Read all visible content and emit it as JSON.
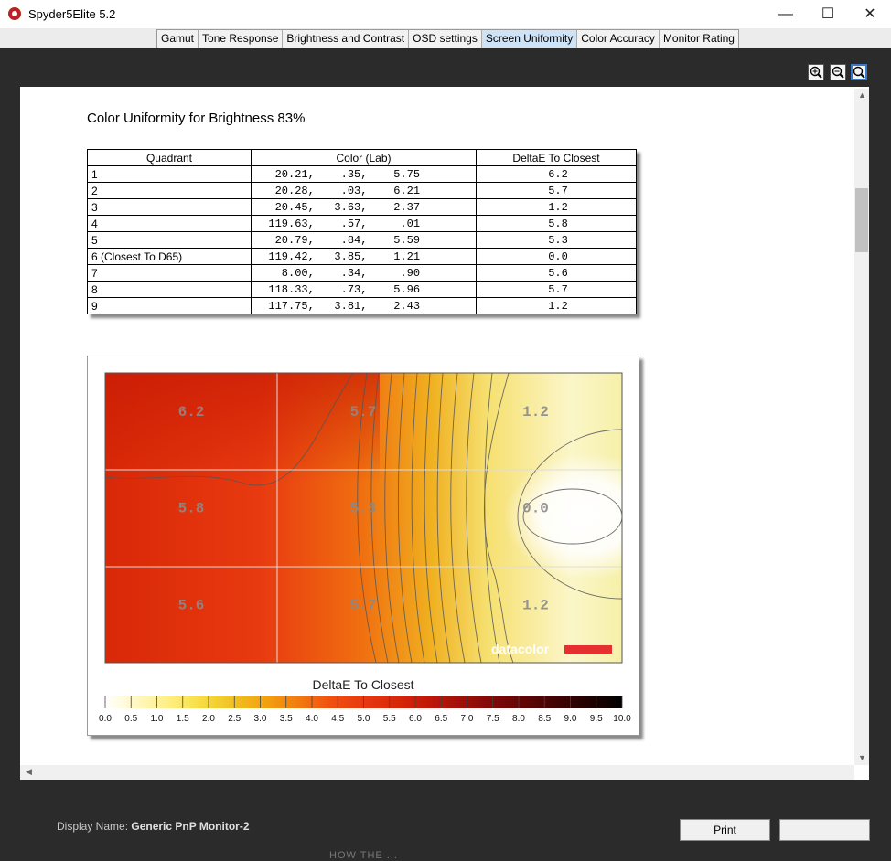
{
  "window": {
    "title": "Spyder5Elite 5.2",
    "minimize": "—",
    "maximize": "☐",
    "close": "✕"
  },
  "tabs": [
    {
      "label": "Gamut"
    },
    {
      "label": "Tone Response"
    },
    {
      "label": "Brightness and Contrast"
    },
    {
      "label": "OSD settings"
    },
    {
      "label": "Screen Uniformity",
      "active": true
    },
    {
      "label": "Color Accuracy"
    },
    {
      "label": "Monitor Rating"
    }
  ],
  "zoom_tools": [
    "zoom-in-icon",
    "zoom-out-icon",
    "zoom-fit-icon"
  ],
  "report": {
    "title": "Color Uniformity for Brightness 83%",
    "table": {
      "headers": [
        "Quadrant",
        "Color (Lab)",
        "DeltaE To Closest"
      ],
      "rows": [
        {
          "quadrant": "1",
          "lab": "   20.21,    .35,    5.75",
          "delta": "6.2"
        },
        {
          "quadrant": "2",
          "lab": "   20.28,    .03,    6.21",
          "delta": "5.7"
        },
        {
          "quadrant": "3",
          "lab": "   20.45,   3.63,    2.37",
          "delta": "1.2"
        },
        {
          "quadrant": "4",
          "lab": "  119.63,    .57,     .01",
          "delta": "5.8"
        },
        {
          "quadrant": "5",
          "lab": "   20.79,    .84,    5.59",
          "delta": "5.3"
        },
        {
          "quadrant": "6 (Closest To D65)",
          "lab": "  119.42,   3.85,    1.21",
          "delta": "0.0"
        },
        {
          "quadrant": "7",
          "lab": "    8.00,    .34,     .90",
          "delta": "5.6"
        },
        {
          "quadrant": "8",
          "lab": "  118.33,    .73,    5.96",
          "delta": "5.7"
        },
        {
          "quadrant": "9",
          "lab": "  117.75,   3.81,    2.43",
          "delta": "1.2"
        }
      ]
    }
  },
  "chart_data": {
    "type": "heatmap",
    "title": "DeltaE To Closest",
    "grid": [
      [
        "6.2",
        "5.7",
        "1.2"
      ],
      [
        "5.8",
        "5.3",
        "0.0"
      ],
      [
        "5.6",
        "5.7",
        "1.2"
      ]
    ],
    "watermark": "datacolor",
    "scale_ticks": [
      "0.0",
      "0.5",
      "1.0",
      "1.5",
      "2.0",
      "2.5",
      "3.0",
      "3.5",
      "4.0",
      "4.5",
      "5.0",
      "5.5",
      "6.0",
      "6.5",
      "7.0",
      "7.5",
      "8.0",
      "8.5",
      "9.0",
      "9.5",
      "10.0"
    ],
    "scale_range": [
      0,
      10
    ],
    "colors": [
      "#ffffff",
      "#fff8c0",
      "#ffee80",
      "#f7dc40",
      "#f0c020",
      "#f2a010",
      "#f27a10",
      "#f05010",
      "#e83810",
      "#d82808",
      "#c01808",
      "#a01008",
      "#800808",
      "#600404",
      "#400202",
      "#200000",
      "#000000"
    ]
  },
  "footer": {
    "display_label": "Display Name:",
    "display_value": "Generic PnP Monitor-2",
    "print_label": "Print",
    "hidden_text": "HOW THE ..."
  }
}
